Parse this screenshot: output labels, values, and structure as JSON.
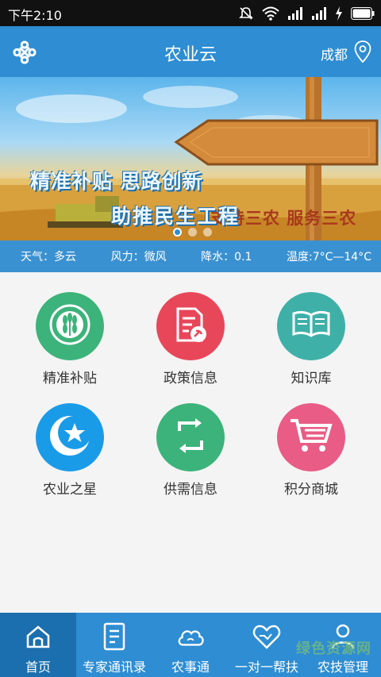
{
  "status_bar": {
    "time": "下午2:10",
    "icons": [
      "mute-icon",
      "wifi-icon",
      "signal-icon",
      "signal-icon",
      "charging-icon",
      "battery-icon"
    ],
    "battery_level": 1.0
  },
  "header": {
    "title": "农业云",
    "city": "成都",
    "logo_icon": "china-unicom-logo-icon",
    "location_icon": "location-pin-icon",
    "color": "#2e8dd3"
  },
  "banner": {
    "sign_text": "支持三农 服务三农",
    "line1": "精准补贴 思路创新",
    "line2": "助推民生工程",
    "slide_count": 3,
    "active_slide": 1
  },
  "weather": {
    "condition": "天气：多云",
    "wind": "风力：微风",
    "rain": "降水：0.1",
    "temperature": "温度:7°C—14°C"
  },
  "grid": [
    {
      "label": "精准补贴",
      "icon": "wheat-icon",
      "color": "#3cb37a"
    },
    {
      "label": "政策信息",
      "icon": "policy-document-icon",
      "color": "#e8475a"
    },
    {
      "label": "知识库",
      "icon": "book-icon",
      "color": "#3fb0a8"
    },
    {
      "label": "农业之星",
      "icon": "star-icon",
      "color": "#1a9be8"
    },
    {
      "label": "供需信息",
      "icon": "exchange-icon",
      "color": "#3cb37a"
    },
    {
      "label": "积分商城",
      "icon": "shopping-cart-icon",
      "color": "#e85c86"
    }
  ],
  "bottom_nav": [
    {
      "label": "首页",
      "icon": "home-icon",
      "active": true
    },
    {
      "label": "专家通讯录",
      "icon": "contacts-book-icon",
      "active": false
    },
    {
      "label": "农事通",
      "icon": "cloud-icon",
      "active": false
    },
    {
      "label": "一对一帮扶",
      "icon": "heart-hands-icon",
      "active": false
    },
    {
      "label": "农技管理",
      "icon": "user-icon",
      "active": false
    }
  ],
  "watermark": "绿色资源网"
}
